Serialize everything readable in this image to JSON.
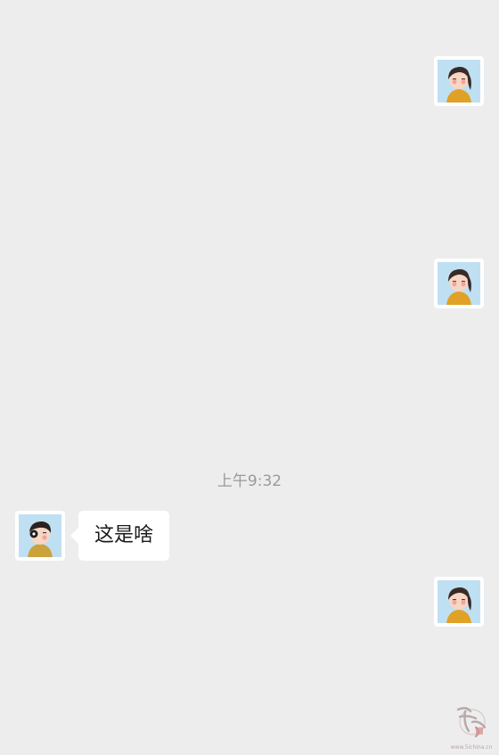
{
  "colors": {
    "background": "#ededed",
    "bubble": "#ffffff",
    "timestamp": "#9a9a9a"
  },
  "messages": [
    {
      "side": "right",
      "type": "avatar-only",
      "avatar": "girl-avatar-icon"
    },
    {
      "side": "right",
      "type": "avatar-only",
      "avatar": "girl-avatar-icon"
    },
    {
      "type": "timestamp",
      "text": "上午9:32"
    },
    {
      "side": "left",
      "type": "text",
      "avatar": "boy-avatar-icon",
      "text": "这是啥"
    },
    {
      "side": "right",
      "type": "avatar-only",
      "avatar": "girl-avatar-icon"
    }
  ],
  "watermark": {
    "logo": "calligraphy-seal-logo",
    "text": "www.5ichina.cn"
  }
}
